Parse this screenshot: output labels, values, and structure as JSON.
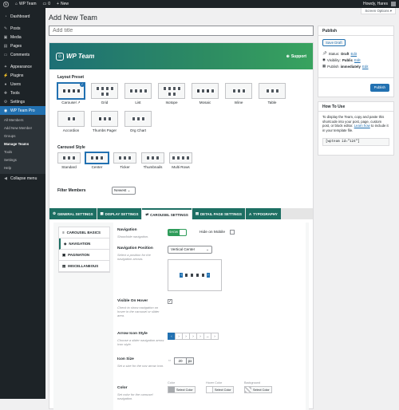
{
  "adminbar": {
    "site_name": "WP Team",
    "comments": "0",
    "new_label": "New",
    "howdy": "Howdy, Hares"
  },
  "sidebar": {
    "items": [
      {
        "label": "Dashboard",
        "icon": "dashboard-icon"
      },
      {
        "label": "Posts",
        "icon": "pin-icon"
      },
      {
        "label": "Media",
        "icon": "media-icon"
      },
      {
        "label": "Pages",
        "icon": "page-icon"
      },
      {
        "label": "Comments",
        "icon": "comment-icon"
      },
      {
        "label": "Appearance",
        "icon": "brush-icon"
      },
      {
        "label": "Plugins",
        "icon": "plug-icon"
      },
      {
        "label": "Users",
        "icon": "user-icon"
      },
      {
        "label": "Tools",
        "icon": "wrench-icon"
      },
      {
        "label": "Settings",
        "icon": "settings-icon"
      },
      {
        "label": "WP Team Pro",
        "icon": "team-icon"
      }
    ],
    "submenu": [
      "All Members",
      "Add New Member",
      "Groups",
      "Manage Teams",
      "Tools",
      "Settings",
      "Help"
    ],
    "collapse": "Collapse menu"
  },
  "header": {
    "screen_options": "Screen Options ▾",
    "title": "Add New Team",
    "title_placeholder": "Add title"
  },
  "team_box": {
    "brand": "WP Team",
    "support": "Support",
    "layout_preset_label": "Layout Preset",
    "layouts": [
      "Carousel",
      "Grid",
      "List",
      "Isotope",
      "Mosaic",
      "Inline",
      "Table",
      "Accordion",
      "Thumbs Pager",
      "Org Chart"
    ],
    "carousel_style_label": "Carousel Style",
    "carousel_styles": [
      "Standard",
      "Center",
      "Ticker",
      "Thumbnails",
      "Multi Rows"
    ],
    "filter_members_label": "Filter Members",
    "filter_members_value": "Newest"
  },
  "tabs": [
    {
      "label": "GENERAL SETTINGS",
      "icon": "gear-icon"
    },
    {
      "label": "DISPLAY SETTINGS",
      "icon": "display-icon"
    },
    {
      "label": "CAROUSEL SETTINGS",
      "icon": "carousel-icon"
    },
    {
      "label": "DETAIL PAGE SETTINGS",
      "icon": "detail-icon"
    },
    {
      "label": "TYPOGRAPHY",
      "icon": "typography-icon"
    }
  ],
  "subtabs": [
    {
      "label": "CAROUSEL BASICS",
      "icon": "sliders-icon"
    },
    {
      "label": "NAVIGATION",
      "icon": "navigation-icon"
    },
    {
      "label": "PAGINATION",
      "icon": "pagination-icon"
    },
    {
      "label": "MISCELLANEOUS",
      "icon": "misc-icon"
    }
  ],
  "fields": {
    "navigation": {
      "label": "Navigation",
      "desc": "Show/hide navigation.",
      "toggle": "SHOW"
    },
    "hide_on_mobile": {
      "label": "Hide on Mobile"
    },
    "nav_position": {
      "label": "Navigation Position",
      "desc": "Select a position for the navigation arrows.",
      "value": "Vertical Center"
    },
    "visible_on_hover": {
      "label": "Visible On Hover",
      "desc": "Check to show navigation on hover in the carousel or slider area."
    },
    "arrow_icon_style": {
      "label": "Arrow Icon Style",
      "desc": "Choose a slider navigation arrow icon style.",
      "arrows": [
        "‹",
        "›",
        "›",
        "›",
        "›",
        "→",
        "›"
      ]
    },
    "icon_size": {
      "label": "Icon Size",
      "desc": "Set a size for the nav arrow icon.",
      "value": "20",
      "unit": "px"
    },
    "color": {
      "label": "Color",
      "desc": "Set color for the carousel navigation.",
      "labels": [
        "Color",
        "Hover Color",
        "Background"
      ],
      "button": "Select Color"
    }
  },
  "publish": {
    "title": "Publish",
    "save_draft": "Save Draft",
    "status_label": "Status:",
    "status_value": "Draft",
    "visibility_label": "Visibility:",
    "visibility_value": "Public",
    "publish_label": "Publish",
    "publish_value": "immediately",
    "edit": "Edit",
    "publish_button": "Publish"
  },
  "howto": {
    "title": "How To Use",
    "text_before": "To display the Team, copy and paste this shortcode into your post, page, custom post, or block editor.",
    "learn_how": "Learn how",
    "text_after": "to include it in your template file.",
    "shortcode": "[wpteam id=\"124\"]"
  },
  "colors": {
    "admin_dark": "#1d2327",
    "accent": "#2271b1",
    "brand_green": "#2d8c62"
  }
}
